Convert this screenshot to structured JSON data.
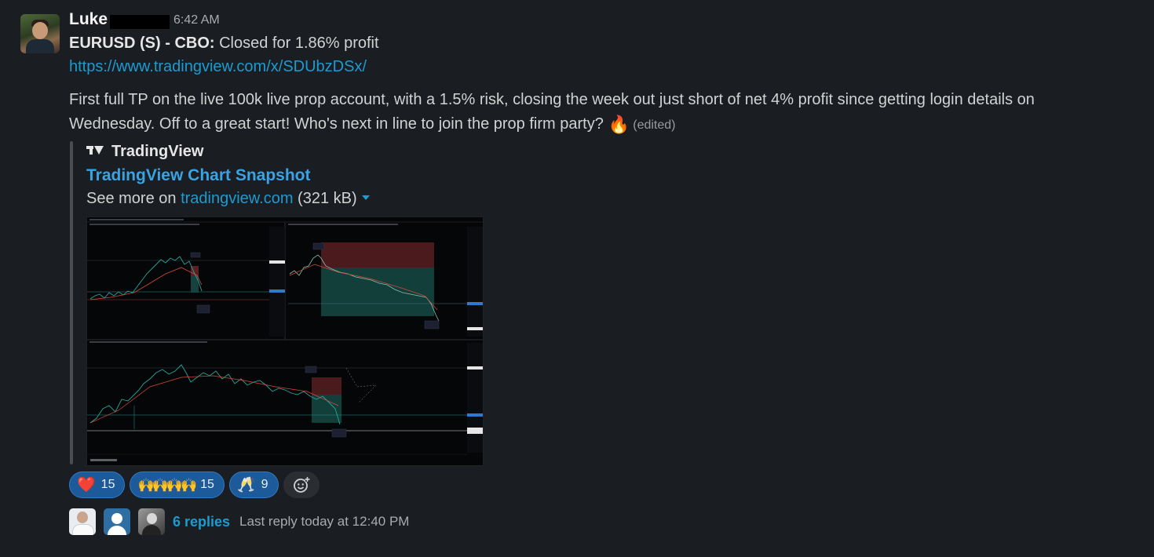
{
  "message": {
    "author": "Luke",
    "time": "6:42 AM",
    "trade_label": "EURUSD (S) - CBO:",
    "trade_result": "Closed for 1.86% profit",
    "link": "https://www.tradingview.com/x/SDUbzDSx/",
    "body_line1": "First full TP on the live 100k live prop account, with a 1.5% risk, closing the week out just short of net 4% profit since getting login details on",
    "body_line2": "Wednesday. Off to a great start! Who's next in line to join the prop firm party?",
    "fire_emoji": "🔥",
    "edited": "(edited)"
  },
  "unfurl": {
    "site": "TradingView",
    "title": "TradingView Chart Snapshot",
    "see_more_prefix": "See more on",
    "see_more_link": "tradingview.com",
    "size": "(321 kB)"
  },
  "reactions": [
    {
      "emoji": "❤️",
      "count": "15"
    },
    {
      "emoji": "🙌🙌🙌🙌",
      "count": "15"
    },
    {
      "emoji": "🥂",
      "count": "9"
    }
  ],
  "thread": {
    "replies": "6 replies",
    "last_reply": "Last reply today at 12:40 PM"
  },
  "colors": {
    "background": "#1a1d21",
    "link": "#1d9bd1",
    "unfurl_title": "#3aa3e3",
    "reaction_bg": "#1c5a9a"
  }
}
